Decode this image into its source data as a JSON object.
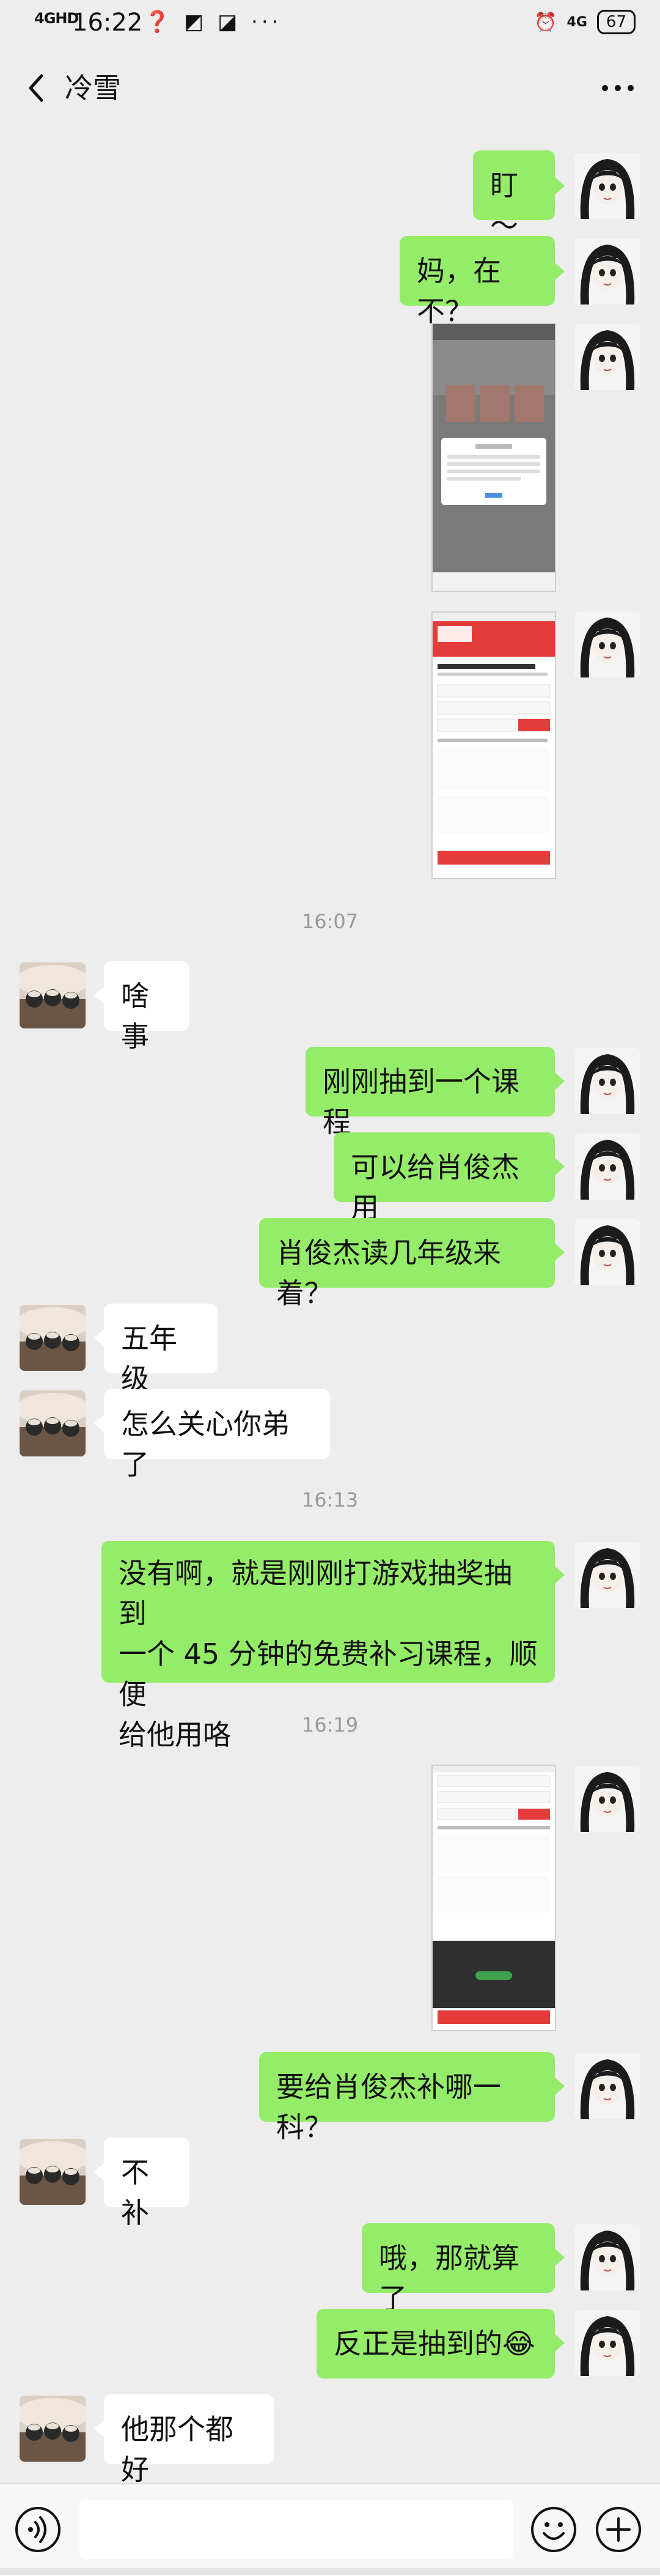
{
  "status_bar": {
    "signal_label": "4GHD",
    "time": "16:22",
    "status_icons": [
      "message-icon",
      "photo-icon",
      "app-icon",
      "more-dots"
    ],
    "status_icons_text": "❓ ◩ ◪ ···",
    "network_label": "4G",
    "battery": "67"
  },
  "header": {
    "title": "冷雪",
    "back_icon": "chevron-left-icon",
    "more_icon": "more-horizontal-icon"
  },
  "timestamps": [
    "16:07",
    "16:13",
    "16:19"
  ],
  "messages": [
    {
      "from": "me",
      "type": "text",
      "text": "盯～"
    },
    {
      "from": "me",
      "type": "text",
      "text": "妈，在不？"
    },
    {
      "from": "me",
      "type": "image",
      "description_label": "screenshot-1"
    },
    {
      "from": "me",
      "type": "image",
      "description_label": "screenshot-2"
    },
    {
      "from": "them",
      "type": "text",
      "text": "啥事"
    },
    {
      "from": "me",
      "type": "text",
      "text": "刚刚抽到一个课程"
    },
    {
      "from": "me",
      "type": "text",
      "text": "可以给肖俊杰用"
    },
    {
      "from": "me",
      "type": "text",
      "text": "肖俊杰读几年级来着？"
    },
    {
      "from": "them",
      "type": "text",
      "text": "五年级"
    },
    {
      "from": "them",
      "type": "text",
      "text": "怎么关心你弟了"
    },
    {
      "from": "me",
      "type": "text",
      "lines": [
        "没有啊，就是刚刚打游戏抽奖抽到",
        "一个 45 分钟的免费补习课程，顺便",
        "给他用咯"
      ]
    },
    {
      "from": "me",
      "type": "image",
      "description_label": "screenshot-3"
    },
    {
      "from": "me",
      "type": "text",
      "text": "要给肖俊杰补哪一科？"
    },
    {
      "from": "them",
      "type": "text",
      "text": "不补"
    },
    {
      "from": "me",
      "type": "text",
      "text": "哦，那就算了"
    },
    {
      "from": "me",
      "type": "text",
      "text": "反正是抽到的😂"
    },
    {
      "from": "them",
      "type": "text",
      "text": "他那个都好"
    }
  ],
  "input_bar": {
    "voice_icon": "voice-icon",
    "input_value": "",
    "emoji_icon": "emoji-icon",
    "plus_icon": "plus-icon"
  },
  "colors": {
    "background": "#ededed",
    "my_bubble": "#95ec69",
    "their_bubble": "#ffffff",
    "timestamp_text": "#999999"
  }
}
